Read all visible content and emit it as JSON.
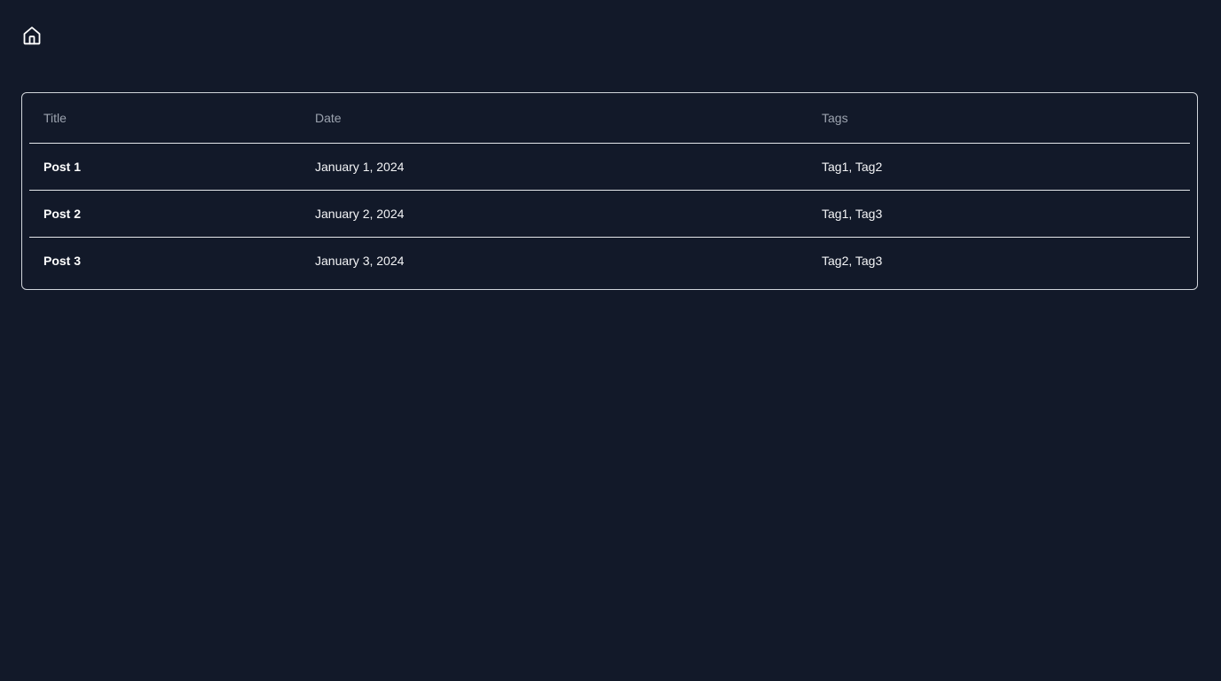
{
  "nav": {
    "home_icon": "home-icon"
  },
  "table": {
    "headers": [
      "Title",
      "Date",
      "Tags"
    ],
    "rows": [
      {
        "title": "Post 1",
        "date": "January 1, 2024",
        "tags": "Tag1, Tag2"
      },
      {
        "title": "Post 2",
        "date": "January 2, 2024",
        "tags": "Tag1, Tag3"
      },
      {
        "title": "Post 3",
        "date": "January 3, 2024",
        "tags": "Tag2, Tag3"
      }
    ]
  },
  "colors": {
    "background": "#121929",
    "border": "#d1d5db",
    "header_text": "#9ca3af",
    "body_text": "#f3f4f6"
  }
}
